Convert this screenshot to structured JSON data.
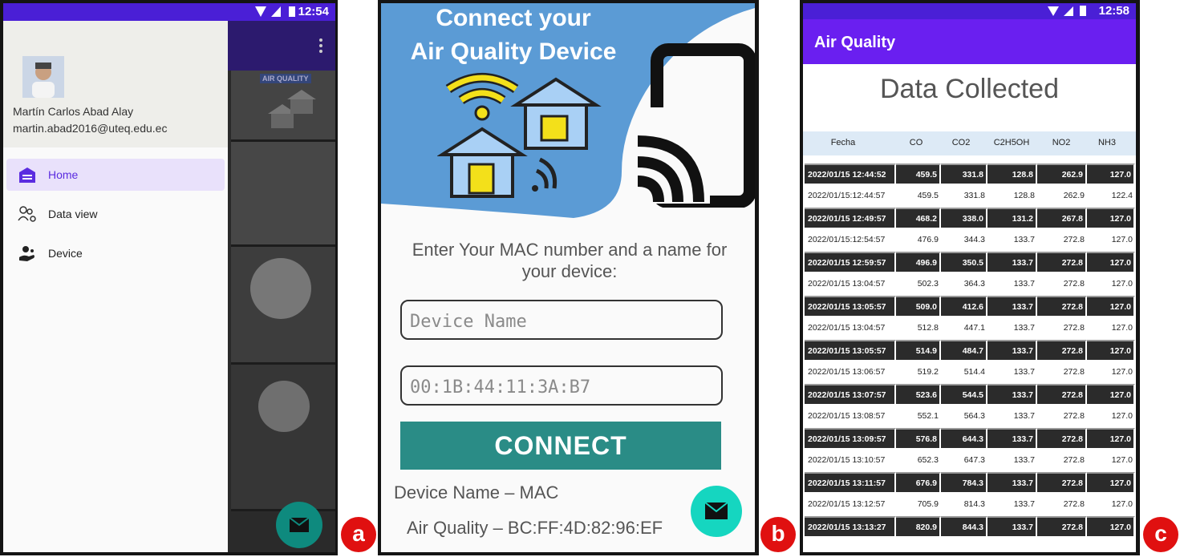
{
  "panel_a": {
    "status": {
      "time": "12:54"
    },
    "drawer": {
      "user_name": "Martín Carlos Abad Alay",
      "user_email": "martin.abad2016@uteq.edu.ec",
      "items": [
        {
          "label": "Home",
          "icon": "home-icon",
          "active": true
        },
        {
          "label": "Data view",
          "icon": "people-settings-icon",
          "active": false
        },
        {
          "label": "Device",
          "icon": "device-hand-icon",
          "active": false
        }
      ]
    },
    "background_banner": "AIR QUALITY",
    "badge": "a"
  },
  "panel_b": {
    "header": {
      "title_line1": "Connect your",
      "title_line2": "Air Quality Device"
    },
    "prompt": "Enter Your MAC number and a name for your device:",
    "device_name_placeholder": "Device Name",
    "mac_placeholder": "00:1B:44:11:3A:B7",
    "connect_label": "CONNECT",
    "list": [
      "Device Name – MAC",
      "Air Quality  – BC:FF:4D:82:96:EF"
    ],
    "badge": "b",
    "colors": {
      "header_blue": "#5b9bd5",
      "connect_teal": "#2a8c86",
      "fab": "#15d6c0"
    }
  },
  "panel_c": {
    "status": {
      "time": "12:58"
    },
    "app_title": "Air Quality",
    "screen_title": "Data Collected",
    "columns": [
      "Fecha",
      "CO",
      "CO2",
      "C2H5OH",
      "NO2",
      "NH3"
    ],
    "rows": [
      [
        "2022/01/15 12:44:52",
        "459.5",
        "331.8",
        "128.8",
        "262.9",
        "127.0"
      ],
      [
        "2022/01/15:12:44:57",
        "459.5",
        "331.8",
        "128.8",
        "262.9",
        "122.4"
      ],
      [
        "2022/01/15 12:49:57",
        "468.2",
        "338.0",
        "131.2",
        "267.8",
        "127.0"
      ],
      [
        "2022/01/15:12:54:57",
        "476.9",
        "344.3",
        "133.7",
        "272.8",
        "127.0"
      ],
      [
        "2022/01/15 12:59:57",
        "496.9",
        "350.5",
        "133.7",
        "272.8",
        "127.0"
      ],
      [
        "2022/01/15 13:04:57",
        "502.3",
        "364.3",
        "133.7",
        "272.8",
        "127.0"
      ],
      [
        "2022/01/15 13:05:57",
        "509.0",
        "412.6",
        "133.7",
        "272.8",
        "127.0"
      ],
      [
        "2022/01/15 13:04:57",
        "512.8",
        "447.1",
        "133.7",
        "272.8",
        "127.0"
      ],
      [
        "2022/01/15 13:05:57",
        "514.9",
        "484.7",
        "133.7",
        "272.8",
        "127.0"
      ],
      [
        "2022/01/15 13:06:57",
        "519.2",
        "514.4",
        "133.7",
        "272.8",
        "127.0"
      ],
      [
        "2022/01/15 13:07:57",
        "523.6",
        "544.5",
        "133.7",
        "272.8",
        "127.0"
      ],
      [
        "2022/01/15 13:08:57",
        "552.1",
        "564.3",
        "133.7",
        "272.8",
        "127.0"
      ],
      [
        "2022/01/15 13:09:57",
        "576.8",
        "644.3",
        "133.7",
        "272.8",
        "127.0"
      ],
      [
        "2022/01/15 13:10:57",
        "652.3",
        "647.3",
        "133.7",
        "272.8",
        "127.0"
      ],
      [
        "2022/01/15 13:11:57",
        "676.9",
        "784.3",
        "133.7",
        "272.8",
        "127.0"
      ],
      [
        "2022/01/15 13:12:57",
        "705.9",
        "814.3",
        "133.7",
        "272.8",
        "127.0"
      ],
      [
        "2022/01/15 13:13:27",
        "820.9",
        "844.3",
        "133.7",
        "272.8",
        "127.0"
      ]
    ],
    "badge": "c"
  }
}
